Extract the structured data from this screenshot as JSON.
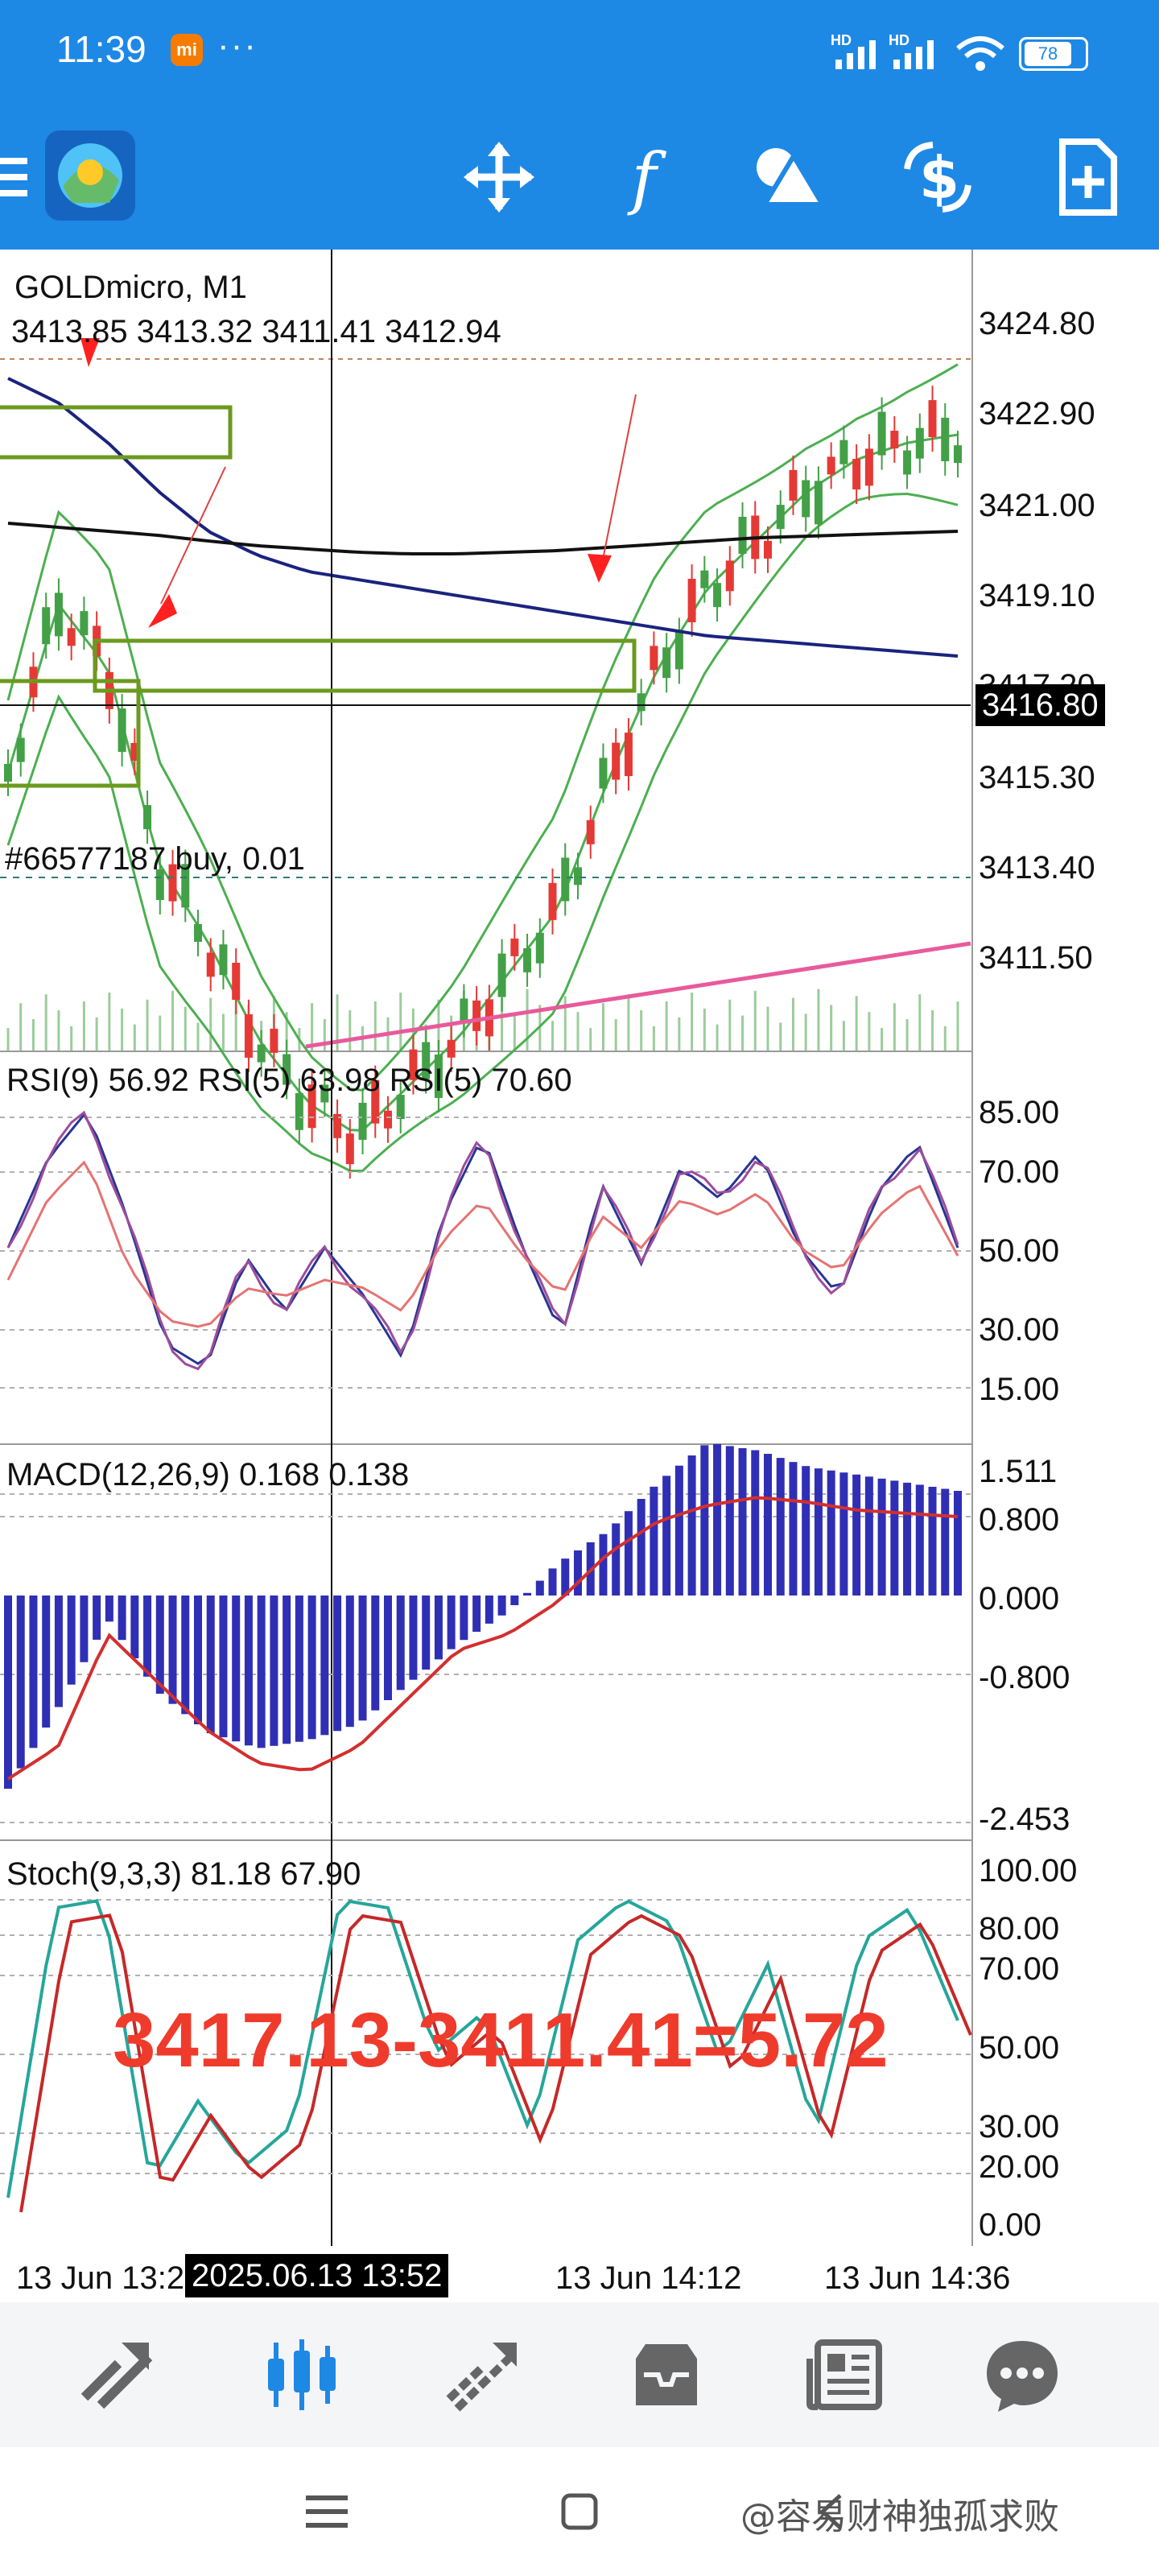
{
  "status_bar": {
    "time": "11:39",
    "mi_badge": "mi",
    "more": "···",
    "network_1": "HD",
    "network_2": "HD",
    "battery": "78"
  },
  "toolbar": {
    "icons": [
      "menu-icon",
      "app-logo-icon",
      "crosshair-move-icon",
      "indicators-icon",
      "objects-icon",
      "trade-icon",
      "new-order-icon"
    ]
  },
  "chart": {
    "symbol_timeframe": "GOLDmicro, M1",
    "ohlc": "3413.85 3413.32 3411.41 3412.94",
    "position_label": "#66577187 buy, 0.01",
    "price_axis": [
      "3424.80",
      "3422.90",
      "3421.00",
      "3419.10",
      "3417.20",
      "3415.30",
      "3413.40",
      "3411.50"
    ],
    "current_price": "3416.80",
    "rsi_label": "RSI(9) 56.92 RSI(5) 63.98 RSI(5) 70.60",
    "rsi_axis": [
      "85.00",
      "70.00",
      "50.00",
      "30.00",
      "15.00"
    ],
    "macd_label": "MACD(12,26,9) 0.168 0.138",
    "macd_axis": [
      "1.511",
      "0.800",
      "0.000",
      "-0.800",
      "-2.453"
    ],
    "annotation": "3417.13-3411.41=5.72",
    "stoch_label": "Stoch(9,3,3) 81.18 67.90",
    "stoch_axis": [
      "100.00",
      "80.00",
      "70.00",
      "50.00",
      "30.00",
      "20.00",
      "0.00"
    ],
    "time_axis": [
      "13 Jun 13:28",
      "13 Jun 14:12",
      "13 Jun 14:36"
    ],
    "crosshair_time": "2025.06.13 13:52",
    "colors": {
      "bull": "#43a047",
      "bear": "#e53935",
      "bands": "#4caf50",
      "ma_blue": "#1a237e",
      "ma_black": "#111111",
      "pink_line": "#e85a9b",
      "rsi_blue": "#283593",
      "rsi_red": "#e57373",
      "rsi_purple": "#9c4d9c",
      "macd_hist": "#2f2fb5",
      "macd_signal": "#d32f2f",
      "stoch_main": "#26a69a",
      "stoch_signal": "#c62828",
      "crosshair": "#111111",
      "price_tag_bg": "#000000"
    }
  },
  "bottom_nav": {
    "items": [
      "quotes-icon",
      "chart-icon",
      "trade-icon",
      "history-icon",
      "news-icon",
      "chat-icon"
    ],
    "active_index": 1
  },
  "watermark": "@容易财神独孤求败"
}
